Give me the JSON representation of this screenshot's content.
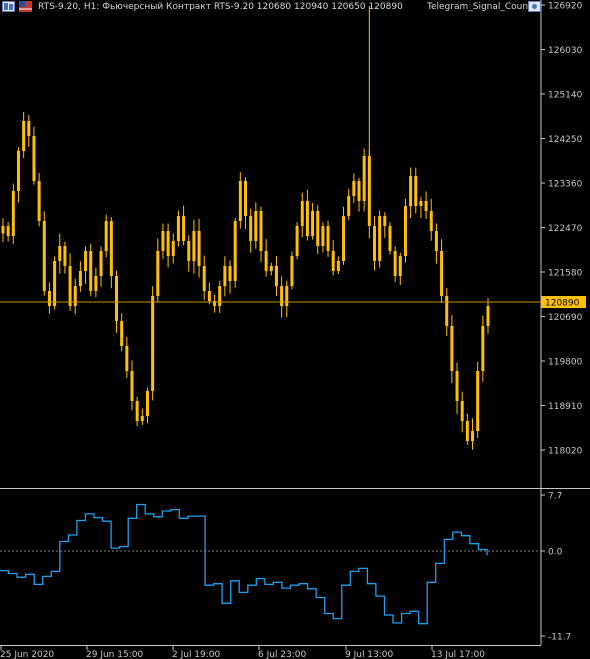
{
  "header": {
    "title": "RTS-9.20, H1:  Фьючерсный Контракт RTS-9.20  120680 120940 120650 120890",
    "indicator_name": "Telegram_Signal_Count"
  },
  "colors": {
    "background": "#000000",
    "candles": "#FFC000",
    "price_line": "#C89600",
    "price_tag_bg": "#FFC000",
    "indicator_line": "#1EA0F0",
    "axis": "#C8C8C8",
    "dotted_zero": "#808080"
  },
  "icons": {
    "left": "chart-window-icon",
    "flag": "flag-icon",
    "indicator": "indicator-window-icon"
  },
  "chart_data": [
    {
      "type": "candlestick",
      "symbol": "RTS-9.20",
      "timeframe": "H1",
      "last_price": "120890",
      "ohlc_last": {
        "open": 120680,
        "high": 120940,
        "low": 120650,
        "close": 120890
      },
      "y_ticks": [
        "126920",
        "126030",
        "125140",
        "124250",
        "123360",
        "122470",
        "121580",
        "120690",
        "119800",
        "118910",
        "118020"
      ],
      "ylim": [
        117500,
        127000
      ],
      "x_ticks": [
        "25 Jun 2020",
        "29 Jun 15:00",
        "2 Jul 19:00",
        "6 Jul 23:00",
        "9 Jul 13:00",
        "13 Jul 17:00"
      ],
      "series": [
        {
          "values": [
            122500,
            122300,
            123200,
            124000,
            124600,
            124300,
            123400,
            122600,
            121200,
            120900,
            121800,
            122100,
            121700,
            120900,
            121300,
            121600,
            122000,
            121200,
            121500,
            122000,
            122600,
            121500,
            120600,
            120100,
            119600,
            119000,
            118600,
            118700,
            119200,
            121100,
            122000,
            122400,
            121900,
            122200,
            122700,
            122200,
            121800,
            122400,
            121700,
            121200,
            121000,
            120900,
            121300,
            121700,
            121400,
            122600,
            123400,
            122700,
            122200,
            122800,
            122000,
            121600,
            121700,
            121300,
            120900,
            121300,
            121900,
            122500,
            123000,
            122300,
            122800,
            122100,
            122500,
            122000,
            121600,
            121800,
            122700,
            123100,
            123400,
            123000,
            123900,
            122500,
            121800,
            122700,
            122500,
            122000,
            121500,
            121900,
            122900,
            123500,
            122900,
            123000,
            122800,
            122400,
            122000,
            121100,
            120500,
            119600,
            119000,
            118600,
            118200,
            118400,
            119600,
            120500,
            120900
          ]
        }
      ]
    },
    {
      "type": "line",
      "indicator": "Telegram_Signal_Count",
      "y_ticks": [
        "7.7",
        "0.0",
        "-11.7"
      ],
      "ylim": [
        -11.7,
        7.7
      ],
      "series": [
        {
          "values": [
            -2.7,
            -3.1,
            -3.6,
            -3.2,
            -4.6,
            -3.5,
            -2.8,
            1.3,
            2.2,
            4.2,
            5.1,
            4.6,
            4.1,
            0.4,
            0.6,
            4.5,
            6.4,
            5.1,
            4.7,
            5.5,
            5.7,
            4.5,
            4.8,
            4.8,
            -4.7,
            -4.5,
            -7.2,
            -4.1,
            -5.7,
            -4.7,
            -3.8,
            -4.6,
            -4.3,
            -5.1,
            -4.7,
            -4.5,
            -5.2,
            -6.4,
            -8.6,
            -9.3,
            -4.7,
            -2.8,
            -2.4,
            -4.5,
            -6.2,
            -8.8,
            -9.9,
            -8.6,
            -8.3,
            -10.0,
            -4.3,
            -1.7,
            1.6,
            2.6,
            2.1,
            1.0,
            0.2,
            -0.6
          ]
        }
      ]
    }
  ]
}
